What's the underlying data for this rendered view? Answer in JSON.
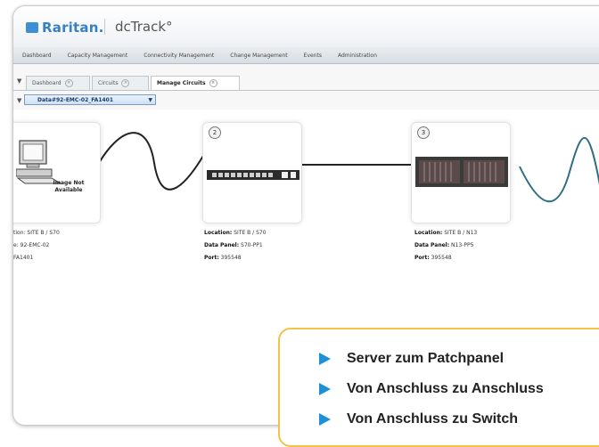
{
  "app": {
    "brand": "Raritan.",
    "title": "dcTrack°"
  },
  "menu": [
    "Dashboard",
    "Capacity Management",
    "Connectivity Management",
    "Change Management",
    "Events",
    "Administration"
  ],
  "tabs": [
    {
      "label": "Dashboard"
    },
    {
      "label": "Circuits"
    },
    {
      "label": "Manage Circuits"
    }
  ],
  "circuit_select": {
    "value": "Data#92-EMC-02_FA1401"
  },
  "nodes": [
    {
      "badge": "",
      "image_label": "Image Not Available",
      "info": [
        "tion: SITE B / S70",
        "e: 92-EMC-02",
        "FA1401"
      ]
    },
    {
      "badge": "2",
      "info_rows": [
        {
          "label": "Location:",
          "value": "SITE B / S70"
        },
        {
          "label": "Data Panel:",
          "value": "S70-PP1"
        },
        {
          "label": "Port:",
          "value": "395548"
        }
      ]
    },
    {
      "badge": "3",
      "info_rows": [
        {
          "label": "Location:",
          "value": "SITE B / N13"
        },
        {
          "label": "Data Panel:",
          "value": "N13-PP5"
        },
        {
          "label": "Port:",
          "value": "395548"
        }
      ]
    }
  ],
  "callout": {
    "items": [
      "Server zum Patchpanel",
      "Von Anschluss zu Anschluss",
      "Von Anschluss zu Switch"
    ]
  },
  "colors": {
    "accent": "#1f8fd6",
    "callout_border": "#f3c247",
    "brand": "#3a7fc0",
    "cable_teal": "#2f6f86"
  }
}
